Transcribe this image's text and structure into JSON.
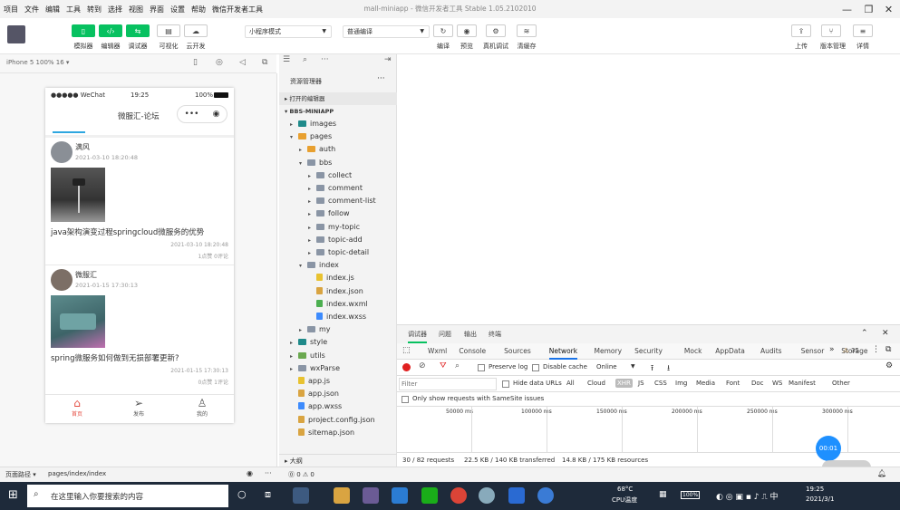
{
  "app": {
    "title": "mall-miniapp - 微信开发者工具 Stable 1.05.2102010"
  },
  "menu": [
    "项目",
    "文件",
    "编辑",
    "工具",
    "转到",
    "选择",
    "视图",
    "界面",
    "设置",
    "帮助",
    "微信开发者工具"
  ],
  "toolbar": {
    "left_buttons": [
      "模拟器",
      "编辑器",
      "调试器",
      "可视化",
      "云开发"
    ],
    "mode_select": "小程序模式",
    "compile_select": "普通编译",
    "mid_buttons": [
      "编译",
      "预览",
      "真机调试",
      "清缓存"
    ],
    "right_buttons": [
      "上传",
      "版本管理",
      "详情"
    ]
  },
  "simulator": {
    "device": "iPhone 5 100% 16 ▾"
  },
  "phone": {
    "status": {
      "carrier": "●●●●● WeChat",
      "time": "19:25",
      "battery": "100%"
    },
    "nav_title": "微服汇-论坛",
    "posts": [
      {
        "author": "满风",
        "date": "2021-03-10 18:20:48",
        "title": "java架构演变过程springcloud微服务的优势",
        "footer_date": "2021-03-10 18:20:48",
        "stats": "1点赞 0评论"
      },
      {
        "author": "微服汇",
        "date": "2021-01-15 17:30:13",
        "title": "spring微服务如何做到无损部署更新?",
        "footer_date": "2021-01-15 17:30:13",
        "stats": "0点赞 1评论"
      }
    ],
    "tabs": [
      "首页",
      "发布",
      "我的"
    ]
  },
  "explorer": {
    "header": "资源管理器",
    "open_editors": "打开的编辑器",
    "project": "BBS-MINIAPP",
    "tree": [
      {
        "name": "images",
        "indent": 1,
        "kind": "folder-teal",
        "chev": "▸"
      },
      {
        "name": "pages",
        "indent": 1,
        "kind": "folder-orange",
        "chev": "▾"
      },
      {
        "name": "auth",
        "indent": 2,
        "kind": "folder-orange",
        "chev": "▸"
      },
      {
        "name": "bbs",
        "indent": 2,
        "kind": "folder-gray",
        "chev": "▾"
      },
      {
        "name": "collect",
        "indent": 3,
        "kind": "folder-gray",
        "chev": "▸"
      },
      {
        "name": "comment",
        "indent": 3,
        "kind": "folder-gray",
        "chev": "▸"
      },
      {
        "name": "comment-list",
        "indent": 3,
        "kind": "folder-gray",
        "chev": "▸"
      },
      {
        "name": "follow",
        "indent": 3,
        "kind": "folder-gray",
        "chev": "▸"
      },
      {
        "name": "my-topic",
        "indent": 3,
        "kind": "folder-gray",
        "chev": "▸"
      },
      {
        "name": "topic-add",
        "indent": 3,
        "kind": "folder-gray",
        "chev": "▸"
      },
      {
        "name": "topic-detail",
        "indent": 3,
        "kind": "folder-gray",
        "chev": "▸"
      },
      {
        "name": "index",
        "indent": 2,
        "kind": "folder-gray",
        "chev": "▾"
      },
      {
        "name": "index.js",
        "indent": 3,
        "kind": "file-js",
        "chev": ""
      },
      {
        "name": "index.json",
        "indent": 3,
        "kind": "file-json",
        "chev": ""
      },
      {
        "name": "index.wxml",
        "indent": 3,
        "kind": "file-wxml",
        "chev": ""
      },
      {
        "name": "index.wxss",
        "indent": 3,
        "kind": "file-wxss",
        "chev": ""
      },
      {
        "name": "my",
        "indent": 2,
        "kind": "folder-gray",
        "chev": "▸"
      },
      {
        "name": "style",
        "indent": 1,
        "kind": "folder-teal",
        "chev": "▸"
      },
      {
        "name": "utils",
        "indent": 1,
        "kind": "folder-green",
        "chev": "▸"
      },
      {
        "name": "wxParse",
        "indent": 1,
        "kind": "folder-gray",
        "chev": "▸"
      },
      {
        "name": "app.js",
        "indent": 1,
        "kind": "file-js",
        "chev": ""
      },
      {
        "name": "app.json",
        "indent": 1,
        "kind": "file-json",
        "chev": ""
      },
      {
        "name": "app.wxss",
        "indent": 1,
        "kind": "file-wxss",
        "chev": ""
      },
      {
        "name": "project.config.json",
        "indent": 1,
        "kind": "file-json",
        "chev": ""
      },
      {
        "name": "sitemap.json",
        "indent": 1,
        "kind": "file-json",
        "chev": ""
      }
    ],
    "outline": "大纲"
  },
  "devtools": {
    "top_tabs": [
      "调试器",
      "问题",
      "输出",
      "终端"
    ],
    "tabs": [
      "Wxml",
      "Console",
      "Sources",
      "Network",
      "Memory",
      "Security",
      "Mock",
      "AppData",
      "Audits",
      "Sensor",
      "Storage"
    ],
    "active_tab": "Network",
    "more": "»",
    "warn_count": "35",
    "preserve_log": "Preserve log",
    "disable_cache": "Disable cache",
    "throttle": "Online",
    "filter_placeholder": "Filter",
    "hide_data_urls": "Hide data URLs",
    "filter_types": [
      "All",
      "Cloud",
      "XHR",
      "JS",
      "CSS",
      "Img",
      "Media",
      "Font",
      "Doc",
      "WS",
      "Manifest",
      "Other"
    ],
    "samesite": "Only show requests with SameSite issues",
    "timeline_ticks": [
      "50000 ms",
      "100000 ms",
      "150000 ms",
      "200000 ms",
      "250000 ms",
      "300000 ms"
    ],
    "summary": [
      "30 / 82 requests",
      "22.5 KB / 140 KB transferred",
      "14.8 KB / 175 KB resources"
    ],
    "timer": "00:01"
  },
  "statusbar": {
    "path_label": "页面路径 ▾",
    "path": "pages/index/index",
    "issues": "⓪ 0 ⚠ 0"
  },
  "taskbar": {
    "search": "在这里输入你要搜索的内容",
    "weather_temp": "68°C",
    "weather_label": "CPU温度",
    "battery": "100%",
    "clock_time": "19:25",
    "clock_date": "2021/3/1"
  }
}
